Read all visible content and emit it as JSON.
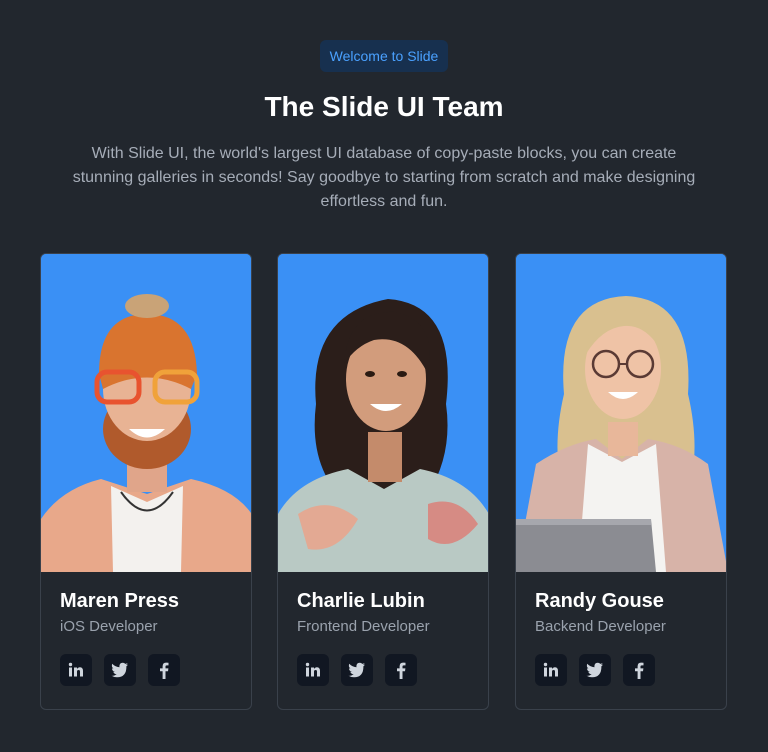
{
  "header": {
    "badge": "Welcome to Slide",
    "title": "The Slide UI Team",
    "subtitle": "With Slide UI, the world's largest UI database of copy-paste blocks, you can create stunning galleries in seconds! Say goodbye to starting from scratch and make designing effortless and fun."
  },
  "colors": {
    "background": "#22272e",
    "accent": "#4aa1ff",
    "photo_bg": "#3a90f5"
  },
  "team": [
    {
      "name": "Maren Press",
      "role": "iOS Developer",
      "socials": [
        "linkedin-icon",
        "twitter-icon",
        "facebook-icon"
      ]
    },
    {
      "name": "Charlie Lubin",
      "role": "Frontend Developer",
      "socials": [
        "linkedin-icon",
        "twitter-icon",
        "facebook-icon"
      ]
    },
    {
      "name": "Randy Gouse",
      "role": "Backend Developer",
      "socials": [
        "linkedin-icon",
        "twitter-icon",
        "facebook-icon"
      ]
    }
  ]
}
